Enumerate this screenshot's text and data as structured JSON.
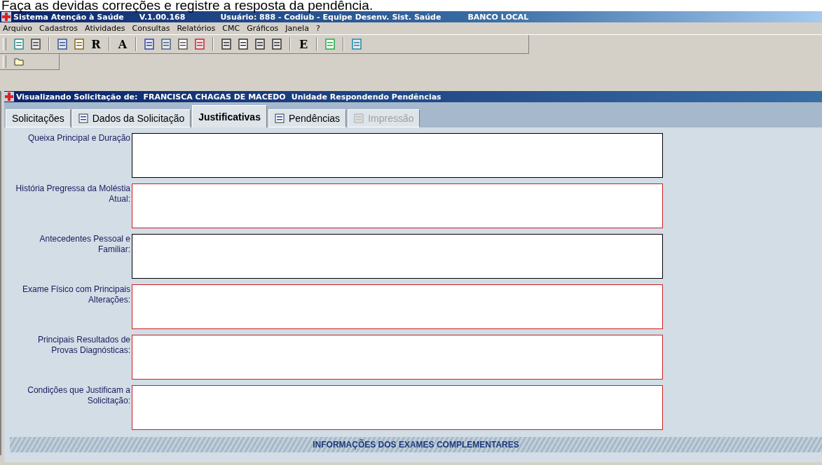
{
  "caption": "Faça as devidas correções e registre a resposta da pendência.",
  "window": {
    "title": "Sistema Atenção à Saúde",
    "version": "V.1.00.168",
    "user": "Usuário: 888 - Codiub - Equipe Desenv. Sist. Saúde",
    "database": "BANCO LOCAL"
  },
  "menu": [
    "Arquivo",
    "Cadastros",
    "Atividades",
    "Consultas",
    "Relatórios",
    "CMC",
    "Gráficos",
    "Janela",
    "?"
  ],
  "toolbar": [
    {
      "kind": "icon"
    },
    {
      "kind": "icon"
    },
    {
      "kind": "separator"
    },
    {
      "kind": "icon"
    },
    {
      "kind": "icon"
    },
    {
      "kind": "letter",
      "text": "R"
    },
    {
      "kind": "separator"
    },
    {
      "kind": "letter",
      "text": "A"
    },
    {
      "kind": "separator"
    },
    {
      "kind": "icon"
    },
    {
      "kind": "icon"
    },
    {
      "kind": "icon"
    },
    {
      "kind": "icon"
    },
    {
      "kind": "separator"
    },
    {
      "kind": "icon"
    },
    {
      "kind": "icon"
    },
    {
      "kind": "icon"
    },
    {
      "kind": "icon"
    },
    {
      "kind": "separator"
    },
    {
      "kind": "letter",
      "text": "E"
    },
    {
      "kind": "separator"
    },
    {
      "kind": "icon"
    },
    {
      "kind": "separator"
    },
    {
      "kind": "icon"
    }
  ],
  "child_window": {
    "title_label": "Visualizando Solicitação de:",
    "patient": "FRANCISCA CHAGAS DE MACEDO",
    "unit": "Unidade Respondendo Pendências"
  },
  "tabs": [
    {
      "label": "Solicitações",
      "selected": false,
      "disabled": false,
      "icon": false
    },
    {
      "label": "Dados da Solicitação",
      "selected": false,
      "disabled": false,
      "icon": true
    },
    {
      "label": "Justificativas",
      "selected": true,
      "disabled": false,
      "icon": false
    },
    {
      "label": "Pendências",
      "selected": false,
      "disabled": false,
      "icon": true
    },
    {
      "label": "Impressão",
      "selected": false,
      "disabled": true,
      "icon": true
    }
  ],
  "fields": [
    {
      "label": "Queixa Principal e Duração",
      "required": false
    },
    {
      "label": "História Pregressa da Moléstia Atual:",
      "required": true
    },
    {
      "label": "Antecedentes Pessoal e Familiar:",
      "required": false
    },
    {
      "label": "Exame Físico com Principais Alterações:",
      "required": true
    },
    {
      "label": "Principais Resultados de Provas Diagnósticas:",
      "required": true
    },
    {
      "label": "Condições que Justificam a Solicitação:",
      "required": true
    }
  ],
  "section_header": "INFORMAÇÕES DOS EXAMES COMPLEMENTARES"
}
